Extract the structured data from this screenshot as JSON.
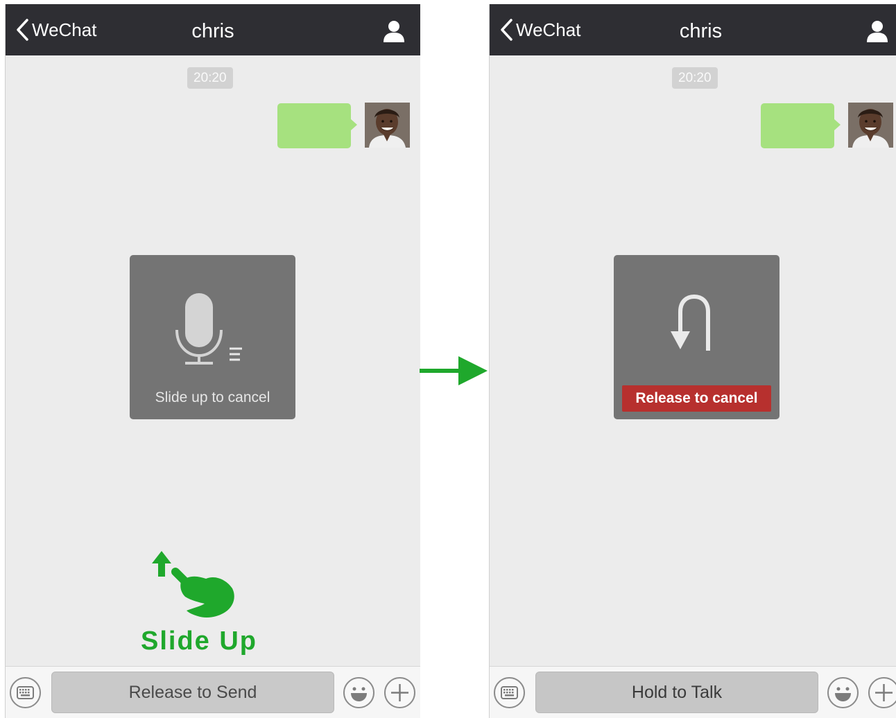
{
  "left": {
    "nav": {
      "back_label": "WeChat",
      "title": "chris"
    },
    "timestamp": "20:20",
    "hud_caption": "Slide up to cancel",
    "input": {
      "talk_label": "Release to Send"
    },
    "annotation": "Slide Up"
  },
  "right": {
    "nav": {
      "back_label": "WeChat",
      "title": "chris"
    },
    "timestamp": "20:20",
    "hud_warning": "Release to cancel",
    "input": {
      "talk_label": "Hold to Talk"
    }
  },
  "colors": {
    "nav_bg": "#2e2e33",
    "chat_bg": "#ececec",
    "bubble": "#a6e17f",
    "hud_bg": "#6e6e6e",
    "warning": "#b7302e",
    "annotation_green": "#1fa82c"
  },
  "icons": {
    "back": "chevron-left-icon",
    "profile": "person-icon",
    "mic": "microphone-icon",
    "undo": "u-turn-arrow-icon",
    "keyboard": "keyboard-icon",
    "emoji": "smiley-icon",
    "plus": "plus-icon",
    "transition": "right-arrow-icon",
    "gesture": "hand-swipe-icon"
  }
}
